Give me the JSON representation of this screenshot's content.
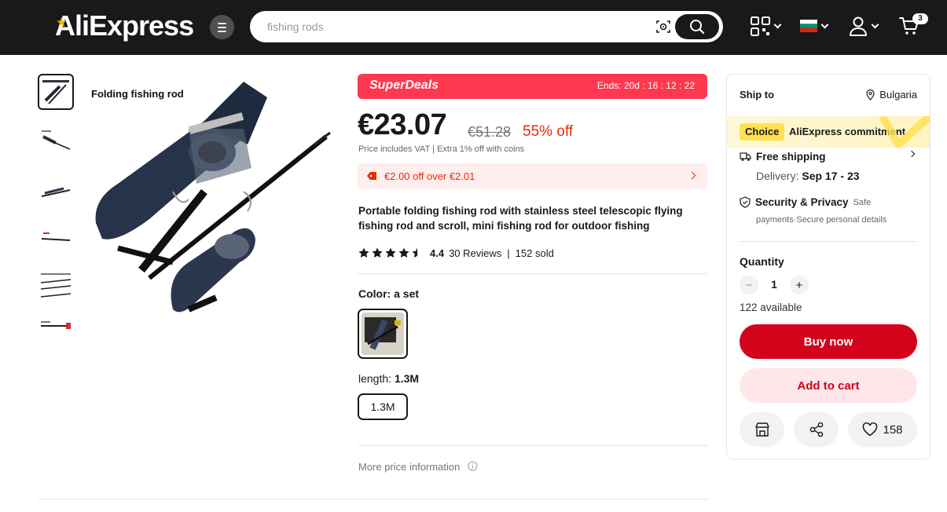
{
  "header": {
    "logo": "AliExpress",
    "search_placeholder": "fishing rods",
    "cart_count": "3"
  },
  "gallery": {
    "image_label": "Folding fishing rod",
    "thumb_count": 6
  },
  "deal": {
    "banner_title": "SuperDeals",
    "ends": "Ends: 20d : 16 : 12 : 22",
    "price": "€23.07",
    "original_price": "€51.28",
    "discount": "55% off",
    "vat_note": "Price includes VAT  |  Extra 1% off with coins",
    "coupon": "€2.00 off over €2.01"
  },
  "product": {
    "title": "Portable folding fishing rod with stainless steel telescopic flying fishing rod and scroll, mini fishing rod for outdoor fishing",
    "rating_value": 4.5,
    "rating": "4.4",
    "reviews": "30 Reviews",
    "sold": "152 sold"
  },
  "options": {
    "color_label": "Color: ",
    "color_value": "a set",
    "length_label": "length: ",
    "length_value": "1.3M",
    "length_option": "1.3M",
    "more_price": "More price information"
  },
  "sidebar": {
    "ship_to": "Ship to",
    "country": "Bulgaria",
    "choice": "Choice",
    "commitment": "AliExpress commitment",
    "free_shipping": "Free shipping",
    "delivery_label": "Delivery: ",
    "delivery_date": "Sep 17 - 23",
    "security_title": "Security & Privacy",
    "security_safe": "Safe",
    "security_sub": "payments·Secure personal details",
    "quantity_label": "Quantity",
    "quantity": "1",
    "available": "122 available",
    "buy_now": "Buy now",
    "add_to_cart": "Add to cart",
    "wishlist_count": "158"
  },
  "colors": {
    "topbar": "#191919",
    "brand_red": "#d3031c",
    "deal_red": "#fd384f",
    "discount": "#e62e04",
    "choice_yellow": "#ffe14f"
  }
}
